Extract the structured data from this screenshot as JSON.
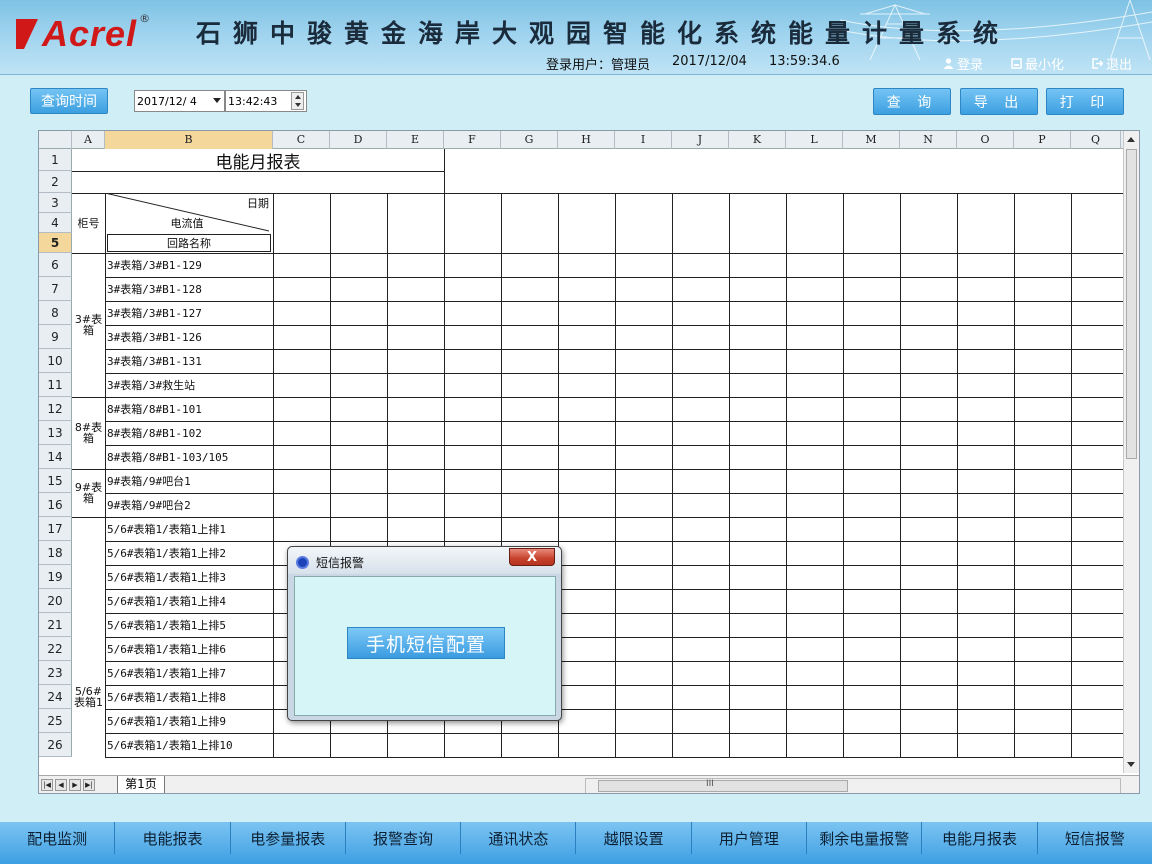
{
  "header": {
    "logo_text": "Acrel",
    "logo_reg": "®",
    "system_title": "石狮中骏黄金海岸大观园智能化系统能量计量系统",
    "login_label": "登录用户：管理员",
    "date": "2017/12/04",
    "time": "13:59:34.6",
    "btn_login": "登录",
    "btn_minimize": "最小化",
    "btn_exit": "退出"
  },
  "toolbar": {
    "query_time_label": "查询时间",
    "date_value": "2017/12/ 4",
    "time_value": "13:42:43",
    "query_label": "查 询",
    "export_label": "导 出",
    "print_label": "打 印"
  },
  "sheet": {
    "columns": [
      "A",
      "B",
      "C",
      "D",
      "E",
      "F",
      "G",
      "H",
      "I",
      "J",
      "K",
      "L",
      "M",
      "N",
      "O",
      "P",
      "Q"
    ],
    "rows": [
      "1",
      "2",
      "3",
      "4",
      "5",
      "6",
      "7",
      "8",
      "9",
      "10",
      "11",
      "12",
      "13",
      "14",
      "15",
      "16",
      "17",
      "18",
      "19",
      "20",
      "21",
      "22",
      "23",
      "24",
      "25",
      "26"
    ],
    "report_title": "电能月报表",
    "header_date": "日期",
    "header_current": "电流值",
    "header_circuit": "回路名称",
    "header_cabinet": "柜号",
    "cabinet_groups": [
      "3#表箱",
      "8#表箱",
      "9#表箱",
      "5/6#表箱1"
    ],
    "circuits": [
      "3#表箱/3#B1-129",
      "3#表箱/3#B1-128",
      "3#表箱/3#B1-127",
      "3#表箱/3#B1-126",
      "3#表箱/3#B1-131",
      "3#表箱/3#救生站",
      "8#表箱/8#B1-101",
      "8#表箱/8#B1-102",
      "8#表箱/8#B1-103/105",
      "9#表箱/9#吧台1",
      "9#表箱/9#吧台2",
      "5/6#表箱1/表箱1上排1",
      "5/6#表箱1/表箱1上排2",
      "5/6#表箱1/表箱1上排3",
      "5/6#表箱1/表箱1上排4",
      "5/6#表箱1/表箱1上排5",
      "5/6#表箱1/表箱1上排6",
      "5/6#表箱1/表箱1上排7",
      "5/6#表箱1/表箱1上排8",
      "5/6#表箱1/表箱1上排9",
      "5/6#表箱1/表箱1上排10"
    ],
    "sheet_tab": "第1页",
    "hscroll_grip": "III"
  },
  "dialog": {
    "title": "短信报警",
    "close_label": "X",
    "sms_config_label": "手机短信配置"
  },
  "bottom_nav": [
    "配电监测",
    "电能报表",
    "电参量报表",
    "报警查询",
    "通讯状态",
    "越限设置",
    "用户管理",
    "剩余电量报警",
    "电能月报表",
    "短信报警"
  ]
}
